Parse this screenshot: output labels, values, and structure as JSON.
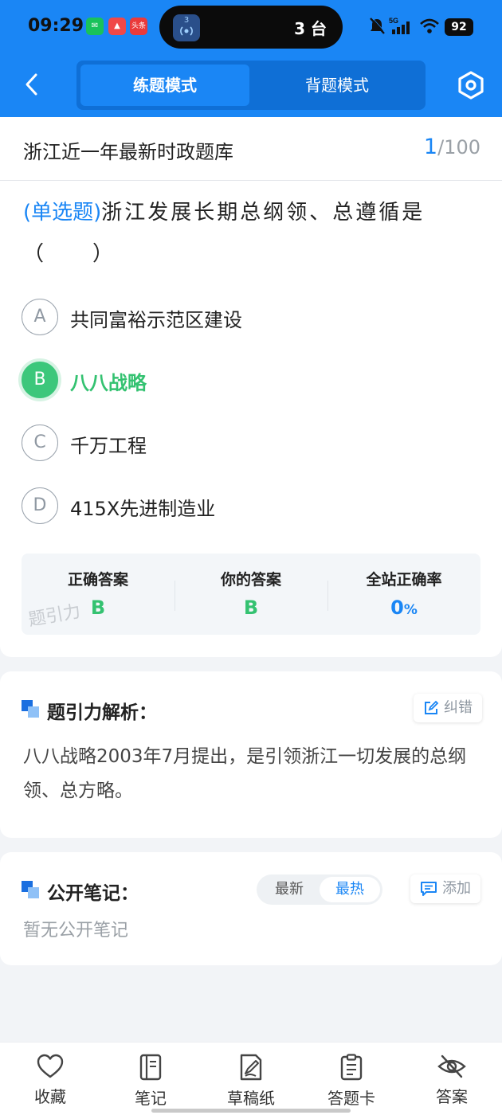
{
  "status_bar": {
    "time": "09:29",
    "island_text": "3 台",
    "island_icon_label": "3",
    "battery": "92",
    "app_icon_label": "头条"
  },
  "nav": {
    "tabs": [
      {
        "label": "练题模式",
        "active": true
      },
      {
        "label": "背题模式",
        "active": false
      }
    ]
  },
  "header": {
    "bank_title": "浙江近一年最新时政题库",
    "current": "1",
    "total": "/100"
  },
  "question": {
    "type": "(单选题)",
    "text": "浙江发展长期总纲领、总遵循是（　　）",
    "options": [
      {
        "letter": "A",
        "text": "共同富裕示范区建设",
        "selected": false
      },
      {
        "letter": "B",
        "text": "八八战略",
        "selected": true
      },
      {
        "letter": "C",
        "text": "千万工程",
        "selected": false
      },
      {
        "letter": "D",
        "text": "415X先进制造业",
        "selected": false
      }
    ]
  },
  "answer_stats": {
    "correct_label": "正确答案",
    "correct_value": "B",
    "yours_label": "你的答案",
    "yours_value": "B",
    "rate_label": "全站正确率",
    "rate_value": "0",
    "rate_unit": "%",
    "watermark": "题引力"
  },
  "analysis": {
    "title": "题引力解析：",
    "report_label": "纠错",
    "text": "八八战略2003年7月提出，是引领浙江一切发展的总纲领、总方略。"
  },
  "notes": {
    "title": "公开笔记：",
    "sort_options": [
      {
        "label": "最新",
        "active": false
      },
      {
        "label": "最热",
        "active": true
      }
    ],
    "add_label": "添加",
    "empty_text": "暂无公开笔记"
  },
  "tabbar": {
    "items": [
      {
        "label": "收藏",
        "icon": "heart-icon"
      },
      {
        "label": "笔记",
        "icon": "notebook-icon"
      },
      {
        "label": "草稿纸",
        "icon": "draft-icon"
      },
      {
        "label": "答题卡",
        "icon": "clipboard-icon"
      },
      {
        "label": "答案",
        "icon": "eye-off-icon"
      }
    ]
  },
  "colors": {
    "primary": "#1a86f5",
    "correct": "#34c271",
    "background": "#f2f4f7"
  }
}
